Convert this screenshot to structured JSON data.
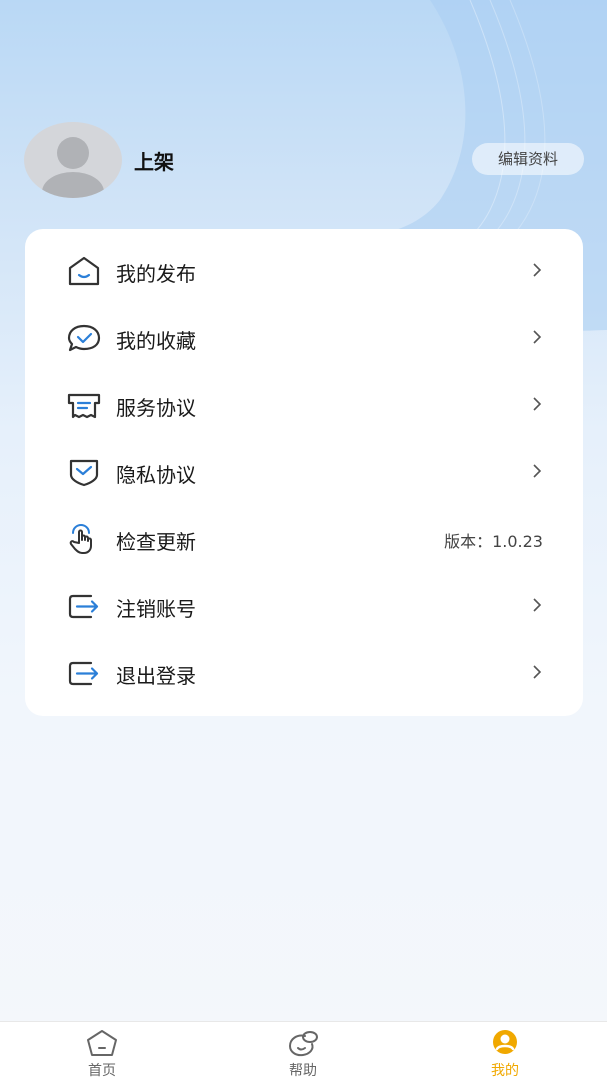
{
  "profile": {
    "username": "上架",
    "edit_label": "编辑资料"
  },
  "menu": {
    "items": [
      {
        "label": "我的发布",
        "icon": "house-icon"
      },
      {
        "label": "我的收藏",
        "icon": "chat-check-icon"
      },
      {
        "label": "服务协议",
        "icon": "receipt-icon"
      },
      {
        "label": "隐私协议",
        "icon": "shield-check-icon"
      },
      {
        "label": "检查更新",
        "icon": "tap-hand-icon",
        "version": "版本：1.0.23"
      },
      {
        "label": "注销账号",
        "icon": "exit-arrow-icon"
      },
      {
        "label": "退出登录",
        "icon": "exit-arrow-icon"
      }
    ]
  },
  "tabbar": {
    "tabs": [
      {
        "label": "首页",
        "icon": "home-icon"
      },
      {
        "label": "帮助",
        "icon": "help-icon"
      },
      {
        "label": "我的",
        "icon": "profile-icon",
        "active": true
      }
    ]
  },
  "colors": {
    "accent": "#f0a800",
    "icon_blue": "#2b7fd8",
    "icon_dark": "#333333"
  }
}
